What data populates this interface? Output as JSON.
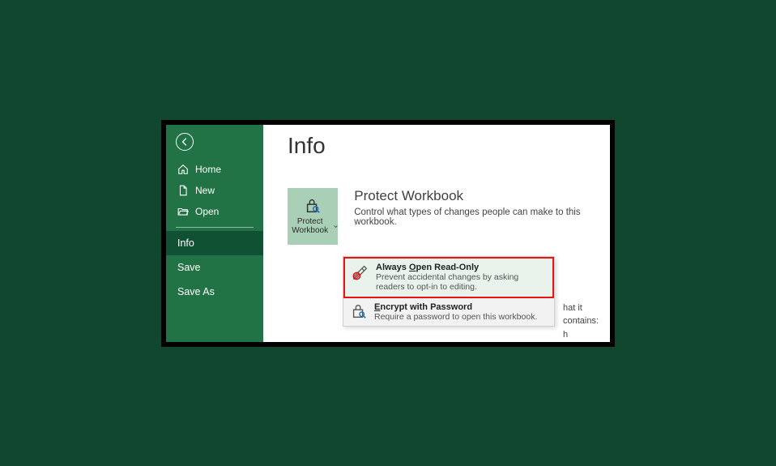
{
  "sidebar": {
    "home": "Home",
    "new": "New",
    "open": "Open",
    "info": "Info",
    "save": "Save",
    "saveas": "Save As"
  },
  "main": {
    "title": "Info",
    "protect_button": "Protect Workbook",
    "section_title": "Protect Workbook",
    "section_desc": "Control what types of changes people can make to this workbook."
  },
  "dropdown": {
    "item1_title_pre": "Always ",
    "item1_title_ul": "O",
    "item1_title_post": "pen Read-Only",
    "item1_desc": "Prevent accidental changes by asking readers to opt-in to editing.",
    "item2_title_pre": "",
    "item2_title_ul": "E",
    "item2_title_post": "ncrypt with Password",
    "item2_desc": "Require a password to open this workbook."
  },
  "behind": {
    "line1": "hat it contains:",
    "line2": "h"
  }
}
